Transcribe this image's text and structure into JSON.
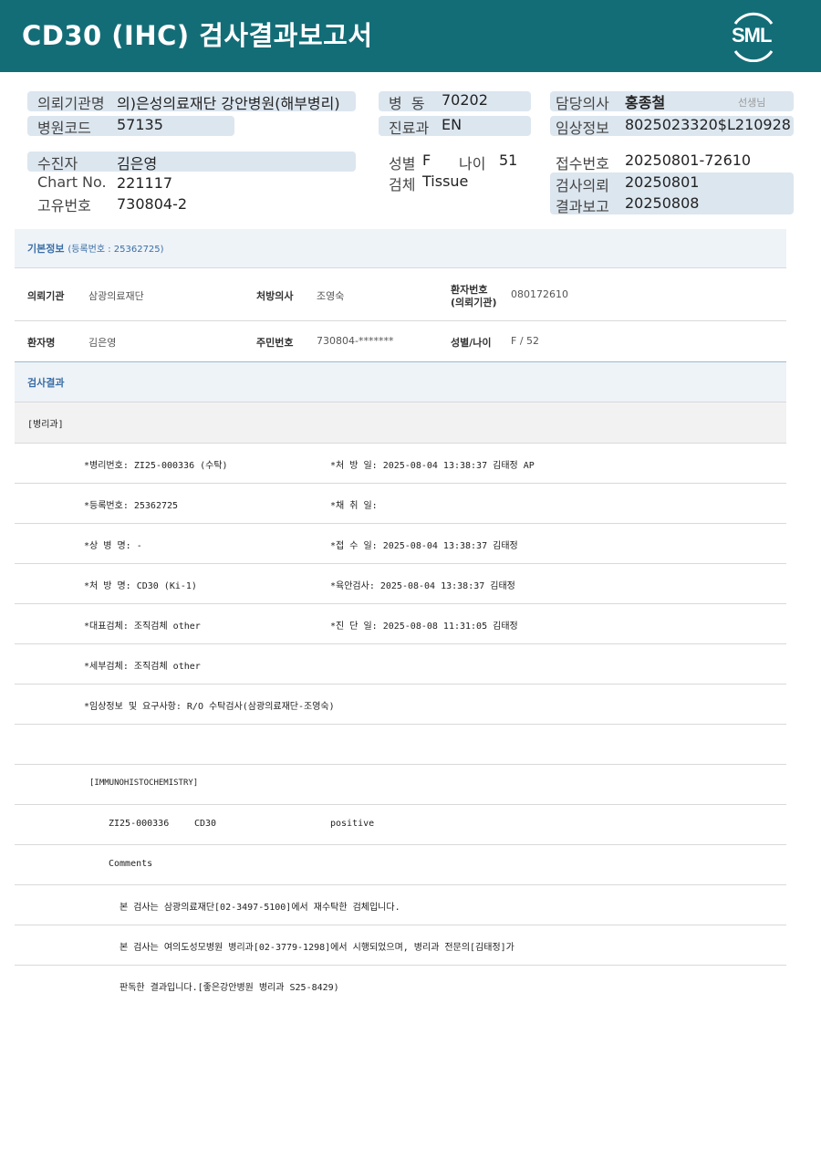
{
  "header": {
    "title": "CD30  (IHC) 검사결과보고서",
    "logo": "SML"
  },
  "patient": {
    "req_org_label": "의뢰기관명",
    "req_org_value": "의)은성의료재단 강안병원(해부병리)",
    "hosp_code_label": "병원코드",
    "hosp_code_value": "57135",
    "ward_label": "병  동",
    "ward_value": "70202",
    "dept_label": "진료과",
    "dept_value": "EN",
    "doctor_label": "담당의사",
    "doctor_value": "홍종철",
    "doctor_suffix": "선생님",
    "clinical_label": "임상정보",
    "clinical_value": "8025023320$L210928",
    "patient_label": "수진자",
    "patient_value": "김은영",
    "chart_label": "Chart No.",
    "chart_value": "221117",
    "id_label": "고유번호",
    "id_value": "730804-2",
    "sex_label": "성별",
    "sex_value": "F",
    "age_label": "나이",
    "age_value": "51",
    "specimen_label": "검체",
    "specimen_value": "Tissue",
    "reception_label": "접수번호",
    "reception_value": "20250801-72610",
    "request_label": "검사의뢰",
    "request_value": "20250801",
    "report_label": "결과보고",
    "report_value": "20250808"
  },
  "basic": {
    "title": "기본정보",
    "reg_no": "(등록번호 : 25362725)",
    "org_label": "의뢰기관",
    "org_value": "삼광의료재단",
    "presc_label": "처방의사",
    "presc_value": "조영숙",
    "pno_label": "환자번호\n(의뢰기관)",
    "pno_label1": "환자번호",
    "pno_label2": "(의뢰기관)",
    "pno_value": "080172610",
    "name_label": "환자명",
    "name_value": "김은영",
    "rrn_label": "주민번호",
    "rrn_value": "730804-*******",
    "sexage_label": "성별/나이",
    "sexage_value": "F / 52"
  },
  "result": {
    "title": "검사결과",
    "dept": "[병리과]",
    "rows": [
      {
        "left": "*병리번호: ZI25-000336 (수탁)",
        "right": "*처 방 일: 2025-08-04 13:38:37  김태정 AP"
      },
      {
        "left": "*등록번호: 25362725",
        "right": "*채 취 일:"
      },
      {
        "left": "*상 병 명: -",
        "right": "*접 수 일: 2025-08-04 13:38:37  김태정"
      },
      {
        "left": "*처 방 명: CD30 (Ki-1)",
        "right": "*육안검사: 2025-08-04 13:38:37  김태정"
      },
      {
        "left": "*대표검체: 조직검체 other",
        "right": "*진 단 일: 2025-08-08 11:31:05  김태정"
      },
      {
        "left": "*세부검체: 조직검체 other",
        "right": ""
      },
      {
        "left": "*임상정보 및 요구사항: R/O 수탁검사(삼광의료재단-조영숙)",
        "right": ""
      }
    ],
    "ihc_title": "[IMMUNOHISTOCHEMISTRY]",
    "ihc_no": "ZI25-000336",
    "ihc_marker": "CD30",
    "ihc_result": "positive",
    "comments_label": "Comments",
    "comment1": "본 검사는 삼광의료재단[02-3497-5100]에서 재수탁한 검체입니다.",
    "comment2": "본 검사는 여의도성모병원 병리과[02-3779-1298]에서 시행되었으며, 병리과 전문의[김태정]가",
    "comment3": "판독한 결과입니다.[좋은강안병원 병리과 S25-8429)"
  }
}
